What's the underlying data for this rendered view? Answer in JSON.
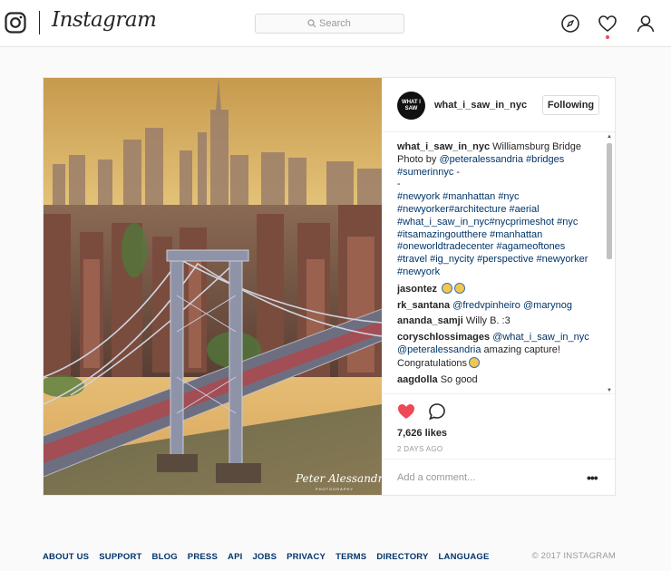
{
  "header": {
    "wordmark": "Instagram",
    "search_placeholder": "Search",
    "notification_dot_color": "#ed4956"
  },
  "post": {
    "author": "what_i_saw_in_nyc",
    "avatar_text": "WHAT I SAW",
    "follow_label": "Following",
    "watermark": "Peter Alessandria",
    "watermark_sub": "PHOTOGRAPHY",
    "caption": {
      "user": "what_i_saw_in_nyc",
      "segments": [
        {
          "t": "Williamsburg Bridge Photo by "
        },
        {
          "t": "@peteralessandria",
          "tag": true
        },
        {
          "t": " "
        },
        {
          "t": "#bridges",
          "tag": true
        },
        {
          "t": " "
        },
        {
          "t": "#sumerinnyc",
          "tag": true
        },
        {
          "t": " -\n-\n"
        },
        {
          "t": "#newyork",
          "tag": true
        },
        {
          "t": " "
        },
        {
          "t": "#manhattan",
          "tag": true
        },
        {
          "t": " "
        },
        {
          "t": "#nyc",
          "tag": true
        },
        {
          "t": "\n"
        },
        {
          "t": "#newyorker#architecture",
          "tag": true
        },
        {
          "t": " "
        },
        {
          "t": "#aerial",
          "tag": true
        },
        {
          "t": "\n"
        },
        {
          "t": "#what_i_saw_in_nyc#nycprimeshot",
          "tag": true
        },
        {
          "t": " "
        },
        {
          "t": "#nyc",
          "tag": true
        },
        {
          "t": "\n"
        },
        {
          "t": "#itsamazingoutthere",
          "tag": true
        },
        {
          "t": " "
        },
        {
          "t": "#manhattan",
          "tag": true
        },
        {
          "t": "\n"
        },
        {
          "t": "#oneworldtradecenter",
          "tag": true
        },
        {
          "t": " "
        },
        {
          "t": "#agameoftones",
          "tag": true
        },
        {
          "t": "\n"
        },
        {
          "t": "#travel",
          "tag": true
        },
        {
          "t": " "
        },
        {
          "t": "#ig_nycity",
          "tag": true
        },
        {
          "t": " "
        },
        {
          "t": "#perspective",
          "tag": true
        },
        {
          "t": " "
        },
        {
          "t": "#newyorker",
          "tag": true
        },
        {
          "t": "\n"
        },
        {
          "t": "#newyork",
          "tag": true
        }
      ]
    },
    "comments": [
      {
        "user": "jasontez",
        "segments": [],
        "emoji": 2
      },
      {
        "user": "rk_santana",
        "segments": [
          {
            "t": "@fredvpinheiro",
            "tag": true
          },
          {
            "t": " "
          },
          {
            "t": "@marynog",
            "tag": true
          }
        ],
        "emoji": 0
      },
      {
        "user": "ananda_samji",
        "segments": [
          {
            "t": "Willy B. :3"
          }
        ],
        "emoji": 0
      },
      {
        "user": "coryschlossimages",
        "segments": [
          {
            "t": "@what_i_saw_in_nyc",
            "tag": true
          },
          {
            "t": " "
          },
          {
            "t": "@peteralessandria",
            "tag": true
          },
          {
            "t": " amazing capture! Congratulations"
          }
        ],
        "emoji": 1
      },
      {
        "user": "aagdolla",
        "segments": [
          {
            "t": "So good"
          }
        ],
        "emoji": 0
      }
    ],
    "likes": "7,626 likes",
    "date": "2 DAYS AGO",
    "liked_color": "#ed4956",
    "add_comment_placeholder": "Add a comment...",
    "more_label": "•••"
  },
  "footer": {
    "links": [
      "ABOUT US",
      "SUPPORT",
      "BLOG",
      "PRESS",
      "API",
      "JOBS",
      "PRIVACY",
      "TERMS",
      "DIRECTORY",
      "LANGUAGE"
    ],
    "copyright": "© 2017 INSTAGRAM"
  }
}
